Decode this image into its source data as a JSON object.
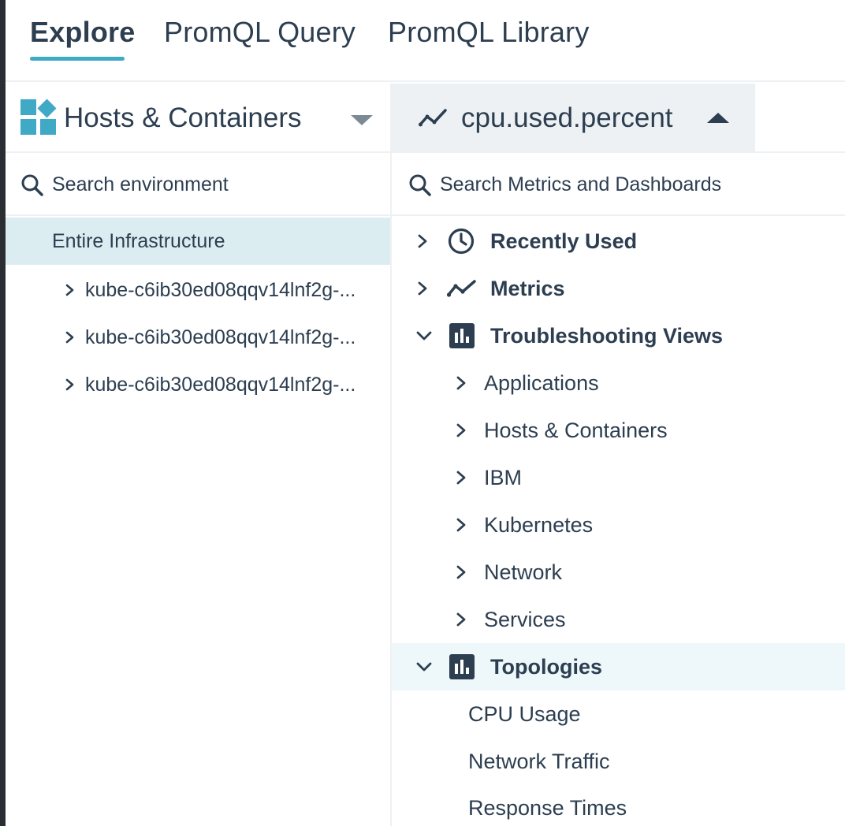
{
  "tabs": [
    {
      "label": "Explore",
      "active": true
    },
    {
      "label": "PromQL Query",
      "active": false
    },
    {
      "label": "PromQL Library",
      "active": false
    }
  ],
  "scope_selector": {
    "label": "Hosts & Containers",
    "icon": "hosts-containers-icon"
  },
  "metric_selector": {
    "label": "cpu.used.percent",
    "icon": "trend-line-icon"
  },
  "search": {
    "environment_placeholder": "Search environment",
    "metrics_placeholder": "Search Metrics and Dashboards"
  },
  "environment": {
    "root": "Entire Infrastructure",
    "nodes": [
      "kube-c6ib30ed08qqv14lnf2g-...",
      "kube-c6ib30ed08qqv14lnf2g-...",
      "kube-c6ib30ed08qqv14lnf2g-..."
    ]
  },
  "metrics_tree": {
    "recently_used": "Recently Used",
    "metrics": "Metrics",
    "troubleshooting_views": {
      "label": "Troubleshooting Views",
      "children": [
        "Applications",
        "Hosts & Containers",
        "IBM",
        "Kubernetes",
        "Network",
        "Services"
      ]
    },
    "topologies": {
      "label": "Topologies",
      "children": [
        "CPU Usage",
        "Network Traffic",
        "Response Times"
      ]
    }
  },
  "colors": {
    "accent": "#3fa9c6",
    "text": "#2c3e50",
    "selected_row": "#dcedf2",
    "hover_row": "#eef8fb"
  }
}
